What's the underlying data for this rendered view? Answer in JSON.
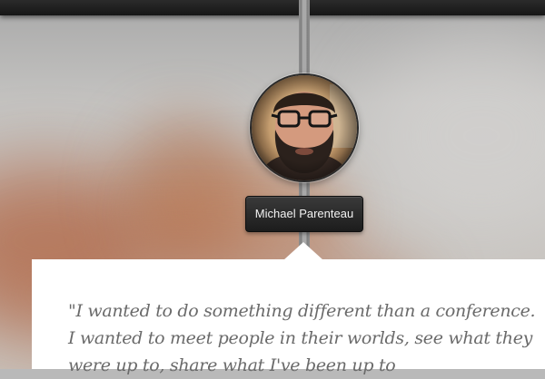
{
  "profile": {
    "name": "Michael Parenteau"
  },
  "testimonial": {
    "quote": "\"I wanted to do something different than a conference. I wanted to meet people in their worlds, see what they were up to, share what I've been up to"
  },
  "icons": {
    "avatar": "bearded-man-with-glasses-avatar-icon"
  },
  "colors": {
    "topbar": "#1c1c1c",
    "tooltip_bg": "#222222",
    "quote_text": "#6a6a6a",
    "card_bg": "#ffffff"
  }
}
